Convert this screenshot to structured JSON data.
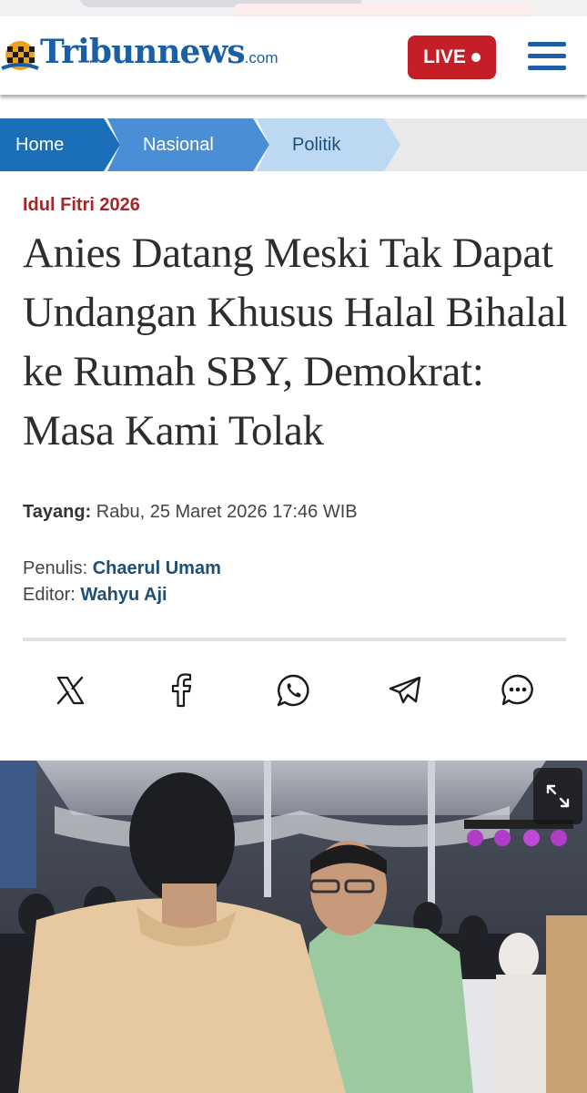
{
  "header": {
    "logo_name": "Tribunnews",
    "logo_suffix": ".com",
    "live_label": "LIVE",
    "menu_icon": "hamburger-menu-icon"
  },
  "breadcrumb": [
    {
      "label": "Home"
    },
    {
      "label": "Nasional"
    },
    {
      "label": "Politik"
    }
  ],
  "article": {
    "category": "Idul Fitri 2026",
    "title_lines": [
      "Anies Datang Meski Tak Dapat",
      "Undangan Khusus Halal Bihalal",
      "ke Rumah SBY, Demokrat:",
      "Masa Kami Tolak"
    ],
    "published_label": "Tayang:",
    "published_value": "Rabu, 25 Maret 2026 17:46 WIB",
    "writer_label": "Penulis:",
    "writer_name": "Chaerul Umam",
    "editor_label": "Editor:",
    "editor_name": "Wahyu Aji"
  },
  "share_icons": [
    "x-icon",
    "facebook-icon",
    "whatsapp-icon",
    "telegram-icon",
    "comment-icon"
  ],
  "photo": {
    "expand_icon": "expand-icon"
  },
  "colors": {
    "brand_blue": "#1a5fa6",
    "live_red": "#c41e26",
    "category_red": "#a3262a",
    "crumb_home": "#1b6fb8",
    "crumb_nasional": "#4a8fd6",
    "crumb_politik": "#bcd8f3"
  }
}
